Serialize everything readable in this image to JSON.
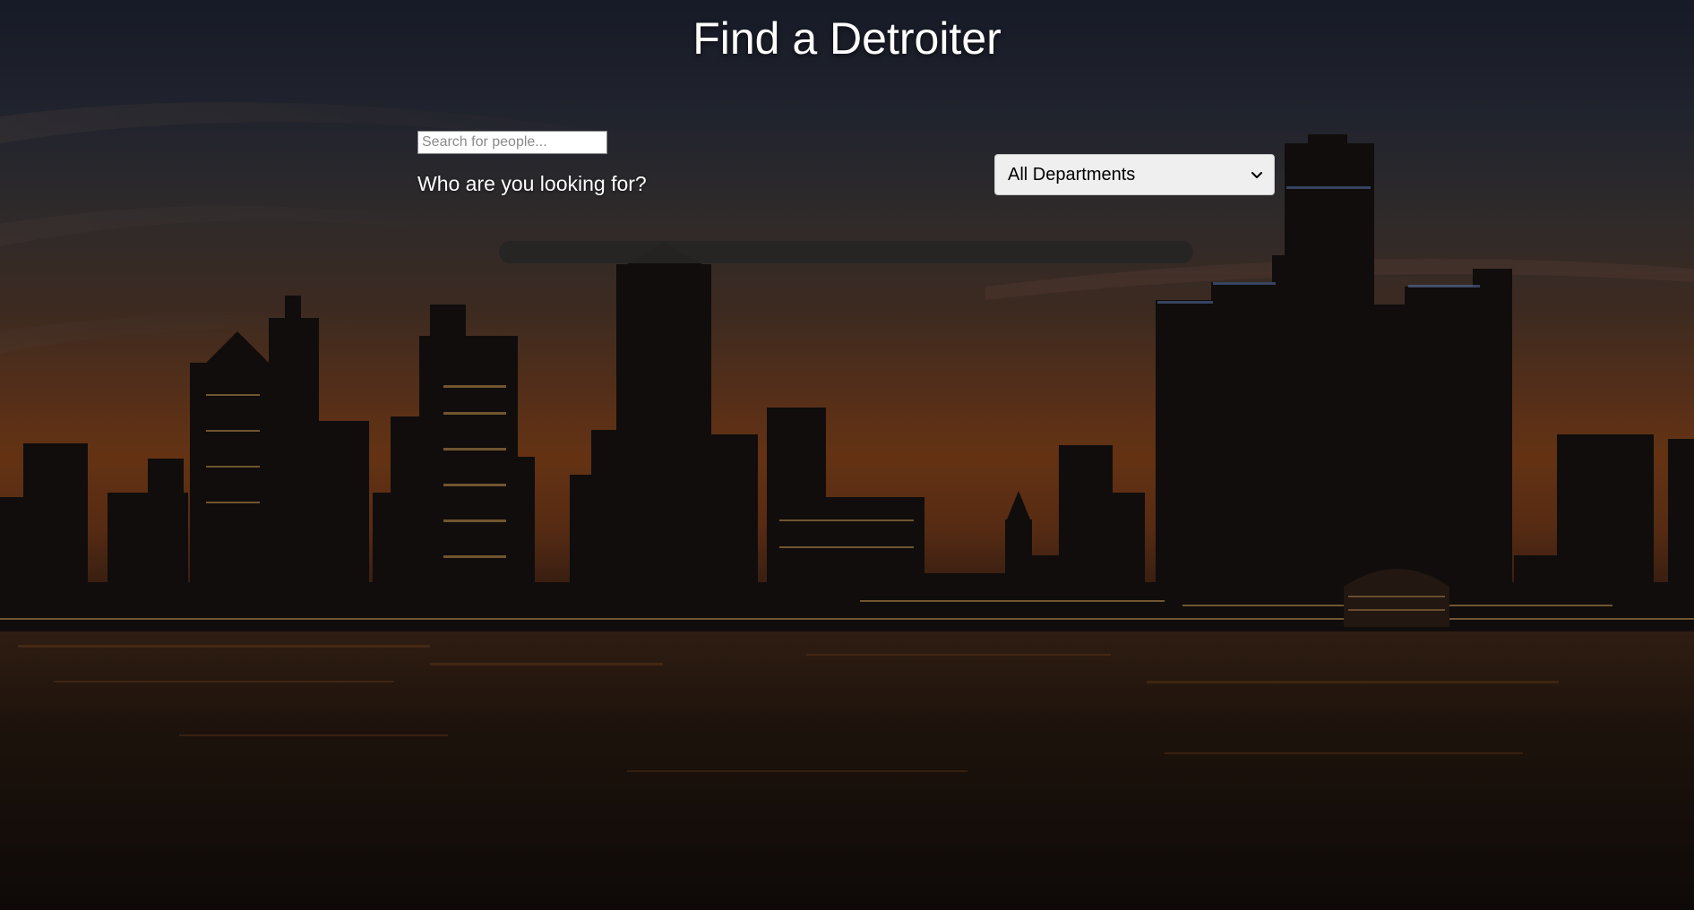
{
  "header": {
    "title": "Find a Detroiter"
  },
  "search": {
    "placeholder": "Search for people...",
    "value": "",
    "prompt": "Who are you looking for?"
  },
  "filter": {
    "selected": "All Departments"
  },
  "results": {
    "items": []
  },
  "background": {
    "icon": "city-skyline-image"
  },
  "colors": {
    "title_text": "#ffffff",
    "select_bg": "#efefef",
    "results_bar": "#262524"
  }
}
